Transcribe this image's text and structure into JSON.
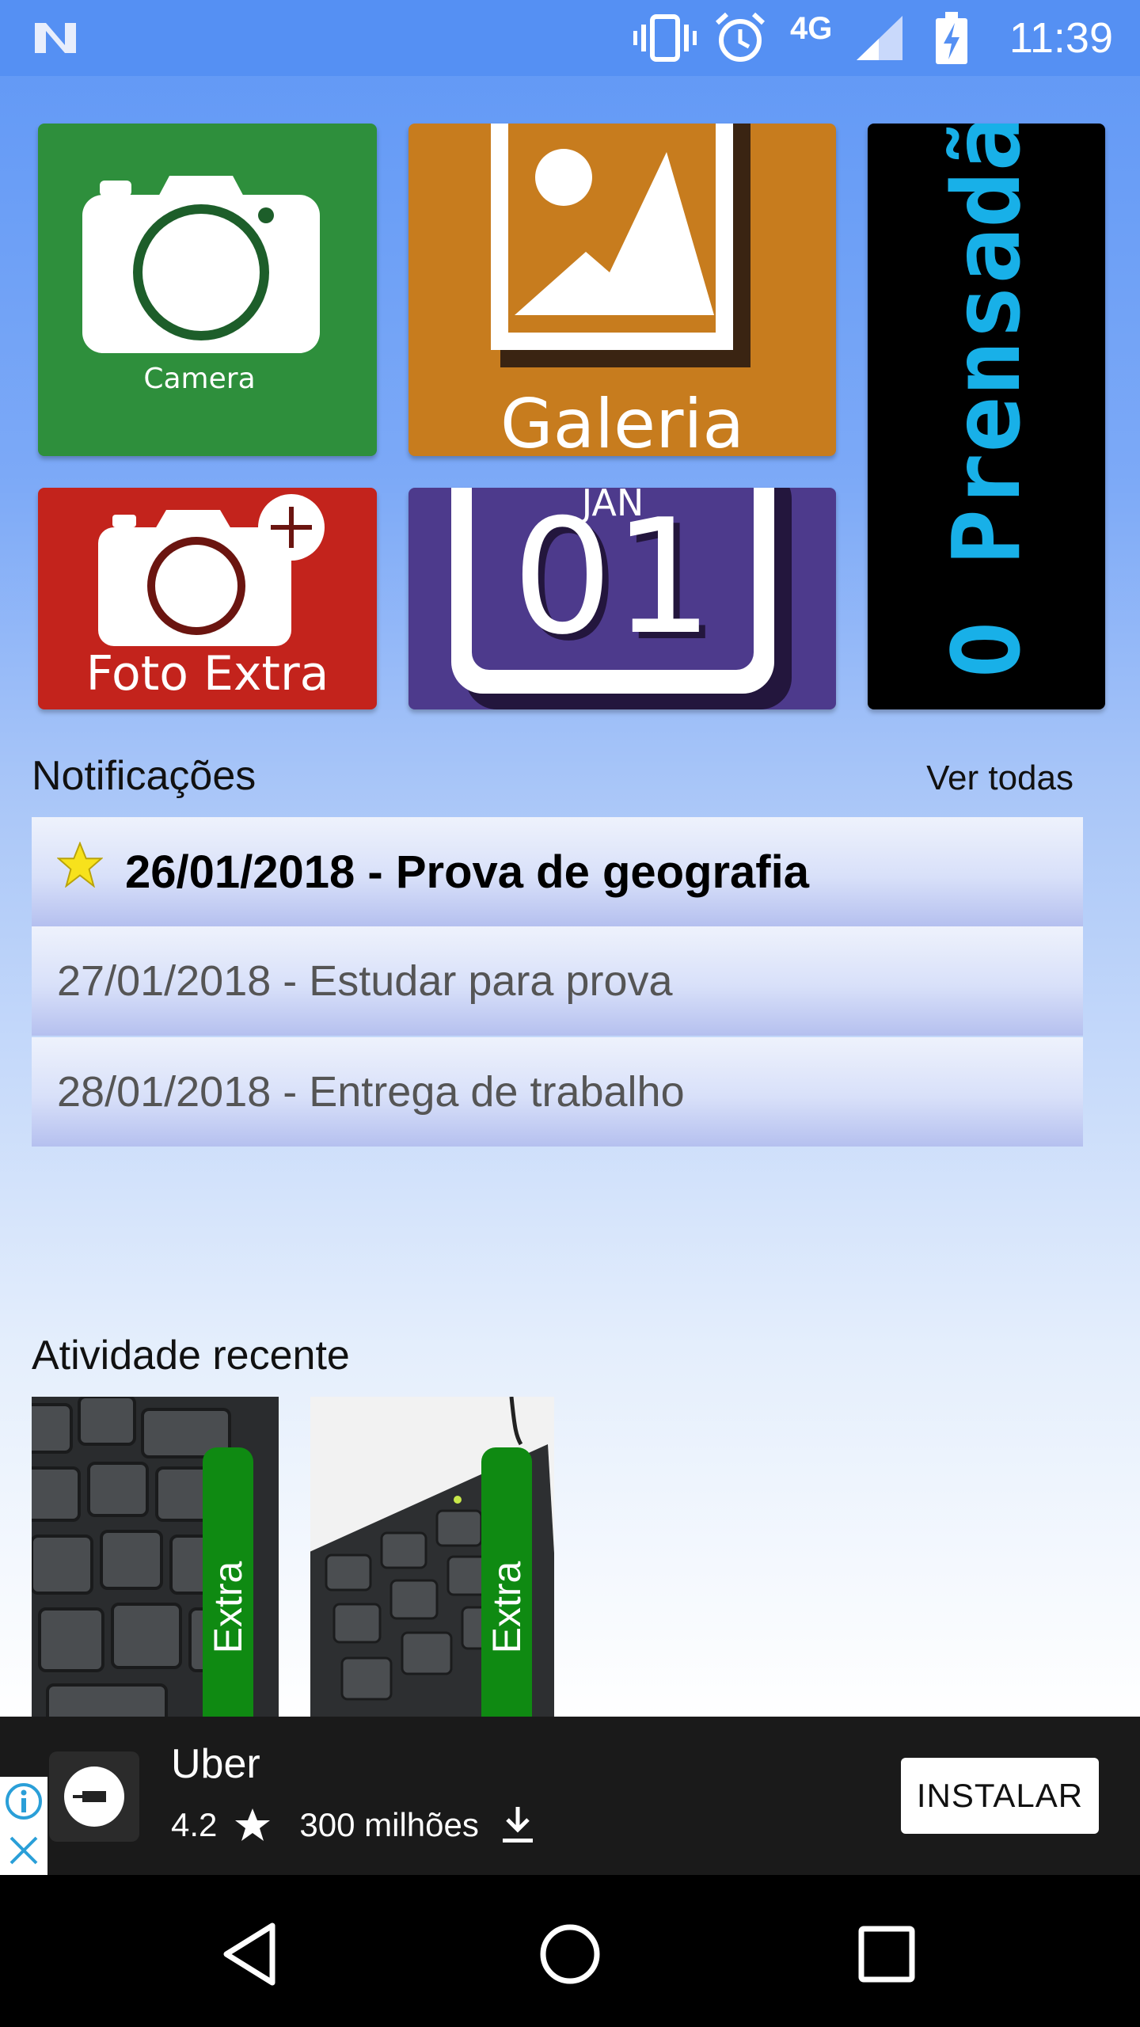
{
  "status_bar": {
    "time": "11:39",
    "network": "4G",
    "icons": [
      "notification-n-icon",
      "vibrate-icon",
      "alarm-icon",
      "signal-icon",
      "battery-charging-icon"
    ]
  },
  "tiles": {
    "camera": {
      "label": "Camera",
      "color": "#2e8f3c"
    },
    "galeria": {
      "label": "Galeria",
      "color": "#c77c1e"
    },
    "foto_extra": {
      "label": "Foto Extra",
      "color": "#c3231c"
    },
    "calendar": {
      "month": "JAN",
      "day": "01",
      "color": "#4d3a8c"
    },
    "prensadao": {
      "label": "O Prensadão",
      "color": "#18b0e8"
    }
  },
  "notifications": {
    "title": "Notificações",
    "see_all": "Ver todas",
    "items": [
      {
        "text": "26/01/2018 - Prova de geografia",
        "starred": true
      },
      {
        "text": "27/01/2018 - Estudar para prova",
        "starred": false
      },
      {
        "text": "28/01/2018 - Entrega de trabalho",
        "starred": false
      }
    ]
  },
  "recent": {
    "title": "Atividade recente",
    "items": [
      {
        "tag": "Extra"
      },
      {
        "tag": "Extra"
      }
    ]
  },
  "ad": {
    "app_name": "Uber",
    "rating": "4.2",
    "installs": "300 milhões",
    "install_button": "INSTALAR"
  },
  "navigation": {
    "buttons": [
      "back-icon",
      "home-icon",
      "recents-icon"
    ]
  }
}
